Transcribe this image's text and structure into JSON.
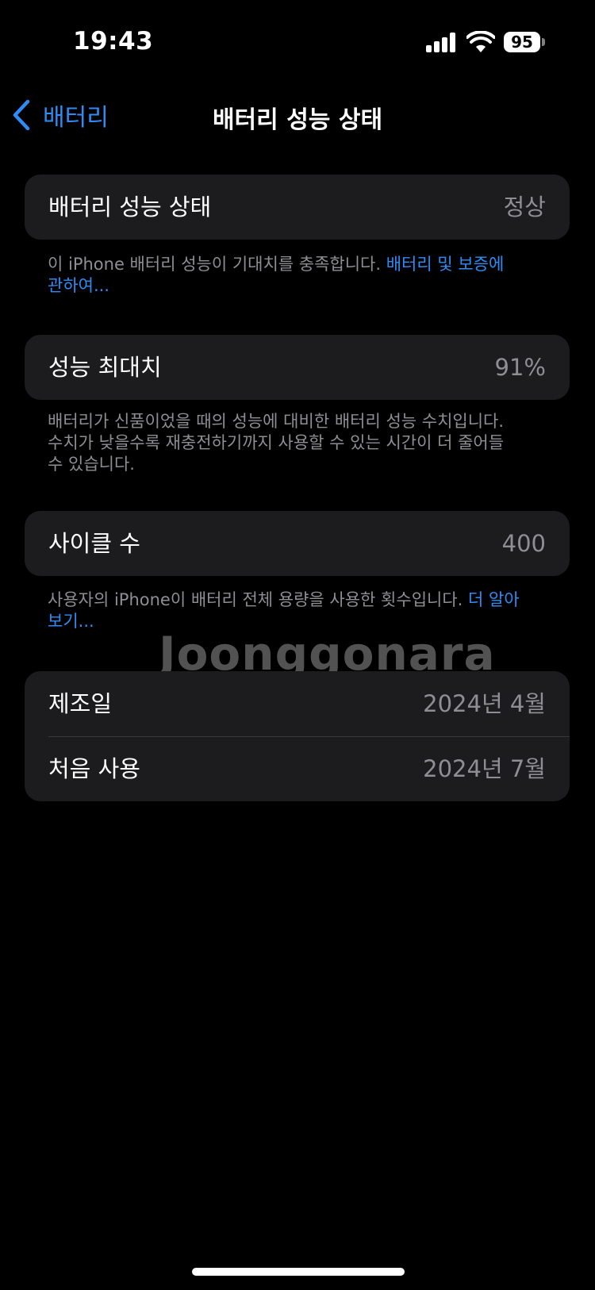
{
  "status_bar": {
    "time": "19:43",
    "battery_level": "95"
  },
  "nav": {
    "back_label": "배터리",
    "title": "배터리 성능 상태"
  },
  "health": {
    "label": "배터리 성능 상태",
    "value": "정상",
    "footnote_text": "이 iPhone 배터리 성능이 기대치를 충족합니다. ",
    "footnote_link": "배터리 및 보증에 관하여..."
  },
  "max_capacity": {
    "label": "성능 최대치",
    "value": "91%",
    "footnote": "배터리가 신품이었을 때의 성능에 대비한 배터리 성능 수치입니다. 수치가 낮을수록 재충전하기까지 사용할 수 있는 시간이 더 줄어들 수 있습니다."
  },
  "cycle_count": {
    "label": "사이클 수",
    "value": "400",
    "footnote_text": "사용자의 iPhone이 배터리 전체 용량을 사용한 횟수입니다. ",
    "footnote_link": "더 알아보기..."
  },
  "dates": {
    "manufacture_label": "제조일",
    "manufacture_value": "2024년 4월",
    "first_use_label": "처음 사용",
    "first_use_value": "2024년 7월"
  },
  "watermark": "Joonggonara",
  "icons": {
    "back": "chevron-left-icon",
    "signal": "cellular-signal-icon",
    "wifi": "wifi-icon",
    "battery": "battery-icon"
  },
  "colors": {
    "accent": "#2f8cf5",
    "card": "#1c1c1e",
    "secondary_text": "#8e8e93"
  }
}
